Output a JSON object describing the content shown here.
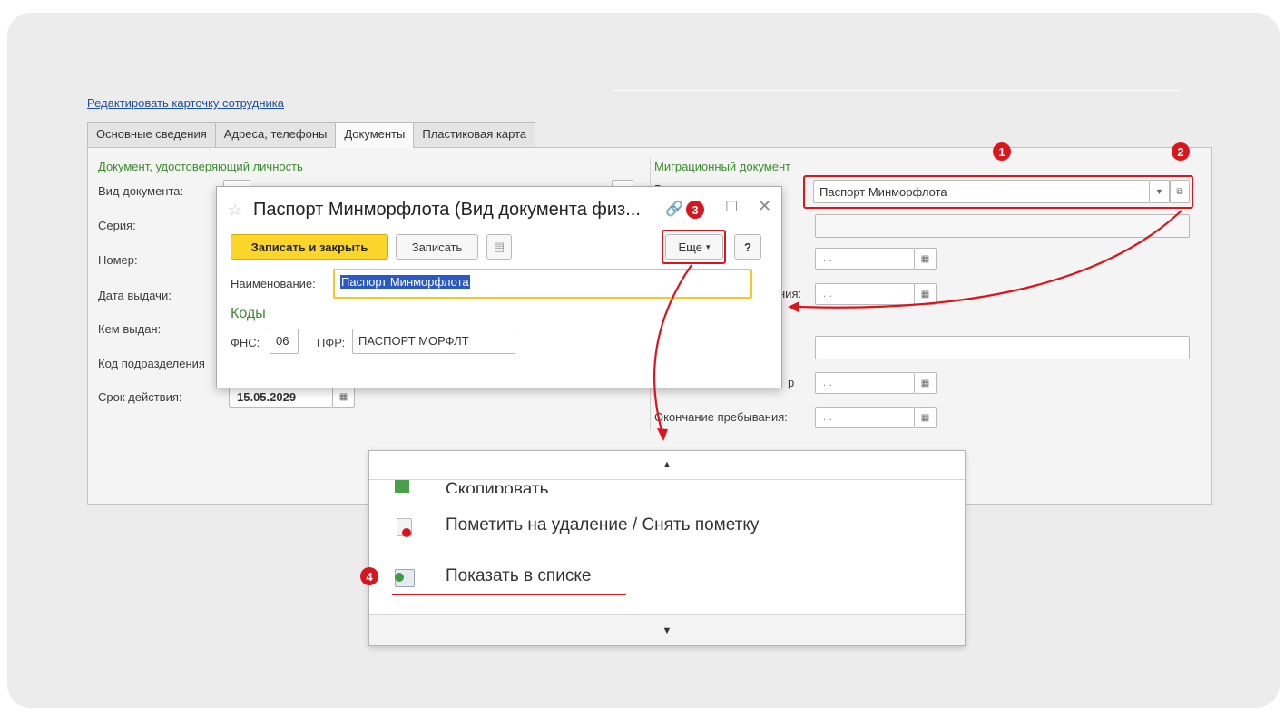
{
  "edit_link": "Редактировать карточку сотрудника",
  "tabs": [
    {
      "label": "Основные сведения"
    },
    {
      "label": "Адреса, телефоны"
    },
    {
      "label": "Документы"
    },
    {
      "label": "Пластиковая карта"
    }
  ],
  "identity": {
    "header": "Документ, удостоверяющий личность",
    "doc_type_label": "Вид документа:",
    "series_label": "Серия:",
    "number_label": "Номер:",
    "issue_date_label": "Дата выдачи:",
    "issued_by_label": "Кем выдан:",
    "dept_code_label": "Код подразделения",
    "expiry_label": "Срок действия:",
    "expiry_value": "15.05.2029"
  },
  "migration": {
    "header": "Миграционный документ",
    "doc_type_value": "Паспорт Минморфлота",
    "date_placeholder": ". .",
    "partial_label_1": "ния:",
    "partial_label_2": "р",
    "stay_end_label": "Окончание пребывания:"
  },
  "dialog": {
    "title": "Паспорт Минморфлота (Вид документа физ...",
    "save_close": "Записать и закрыть",
    "save": "Записать",
    "more": "Еще",
    "help": "?",
    "name_label": "Наименование:",
    "name_value": "Паспорт Минморфлота",
    "codes_header": "Коды",
    "fns_label": "ФНС:",
    "fns_value": "06",
    "pfr_label": "ПФР:",
    "pfr_value": "ПАСПОРТ МОРФЛТ"
  },
  "menu": {
    "items": [
      {
        "label": "Скопировать",
        "icon": "copy-icon"
      },
      {
        "label": "Пометить на удаление / Снять пометку",
        "icon": "delete-mark-icon"
      },
      {
        "label": "Показать в списке",
        "icon": "show-in-list-icon"
      }
    ]
  },
  "badges": [
    "1",
    "2",
    "3",
    "4"
  ],
  "colors": {
    "accent_red": "#d9161e",
    "primary_button": "#fbd52a",
    "section_green": "#3d8a2f"
  }
}
